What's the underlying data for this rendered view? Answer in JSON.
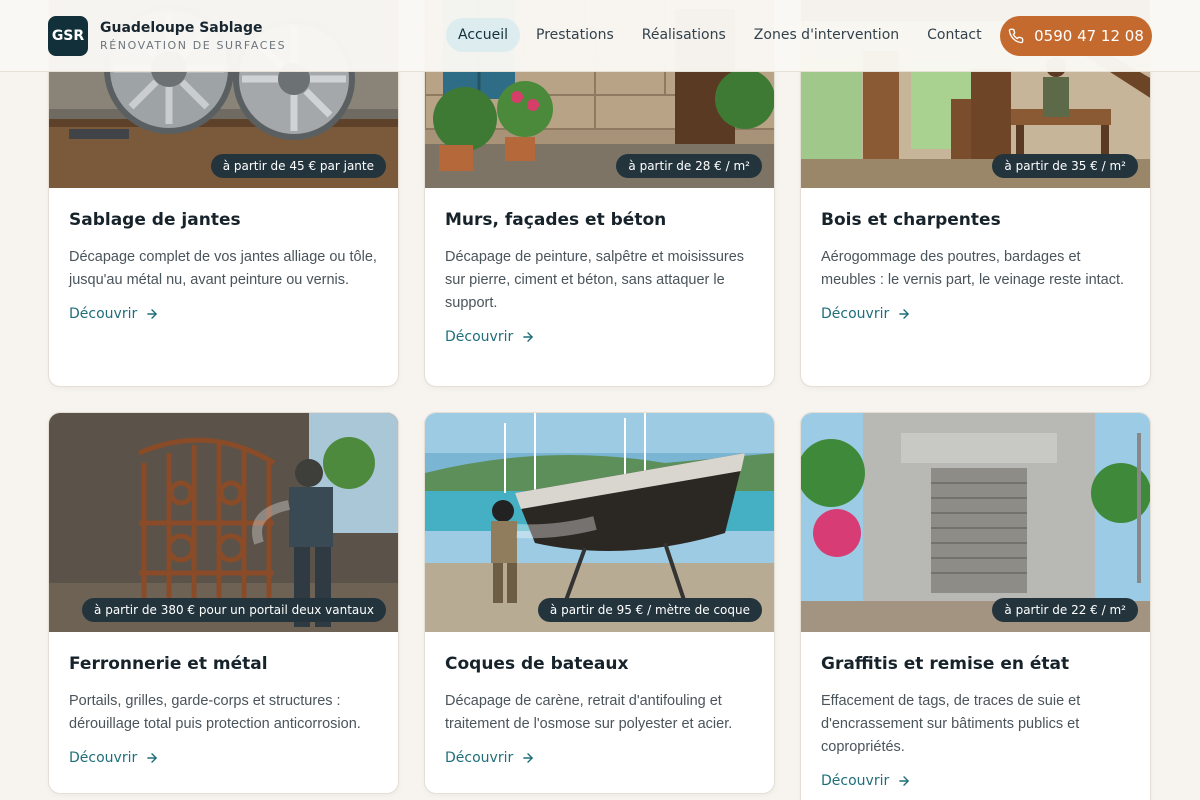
{
  "brand": {
    "logo_text": "GSR",
    "name": "Guadeloupe Sablage",
    "tagline": "RÉNOVATION DE SURFACES"
  },
  "nav": {
    "items": [
      "Accueil",
      "Prestations",
      "Réalisations",
      "Zones d'intervention",
      "Contact"
    ],
    "active": "Accueil"
  },
  "phone": {
    "label": "0590 47 12 08",
    "icon": "phone-icon"
  },
  "colors": {
    "accent": "#c56a2e",
    "dark": "#12303a",
    "link": "#1f6e78"
  },
  "link_label": "Découvrir",
  "services": [
    {
      "title": "Sablage de jantes",
      "price": "à partir de 45 € par jante",
      "desc": "Décapage complet de vos jantes alliage ou tôle, jusqu'au métal nu, avant peinture ou vernis."
    },
    {
      "title": "Murs, façades et béton",
      "price": "à partir de 28 € / m²",
      "desc": "Décapage de peinture, salpêtre et moisissures sur pierre, ciment et béton, sans attaquer le support."
    },
    {
      "title": "Bois et charpentes",
      "price": "à partir de 35 € / m²",
      "desc": "Aérogommage des poutres, bardages et meubles : le vernis part, le veinage reste intact."
    },
    {
      "title": "Ferronnerie et métal",
      "price": "à partir de 380 € pour un portail deux vantaux",
      "desc": "Portails, grilles, garde-corps et structures : dérouillage total puis protection anticorrosion."
    },
    {
      "title": "Coques de bateaux",
      "price": "à partir de 95 € / mètre de coque",
      "desc": "Décapage de carène, retrait d'antifouling et traitement de l'osmose sur polyester et acier."
    },
    {
      "title": "Graffitis et remise en état",
      "price": "à partir de 22 € / m²",
      "desc": "Effacement de tags, de traces de suie et d'encrassement sur bâtiments publics et copropriétés."
    }
  ]
}
